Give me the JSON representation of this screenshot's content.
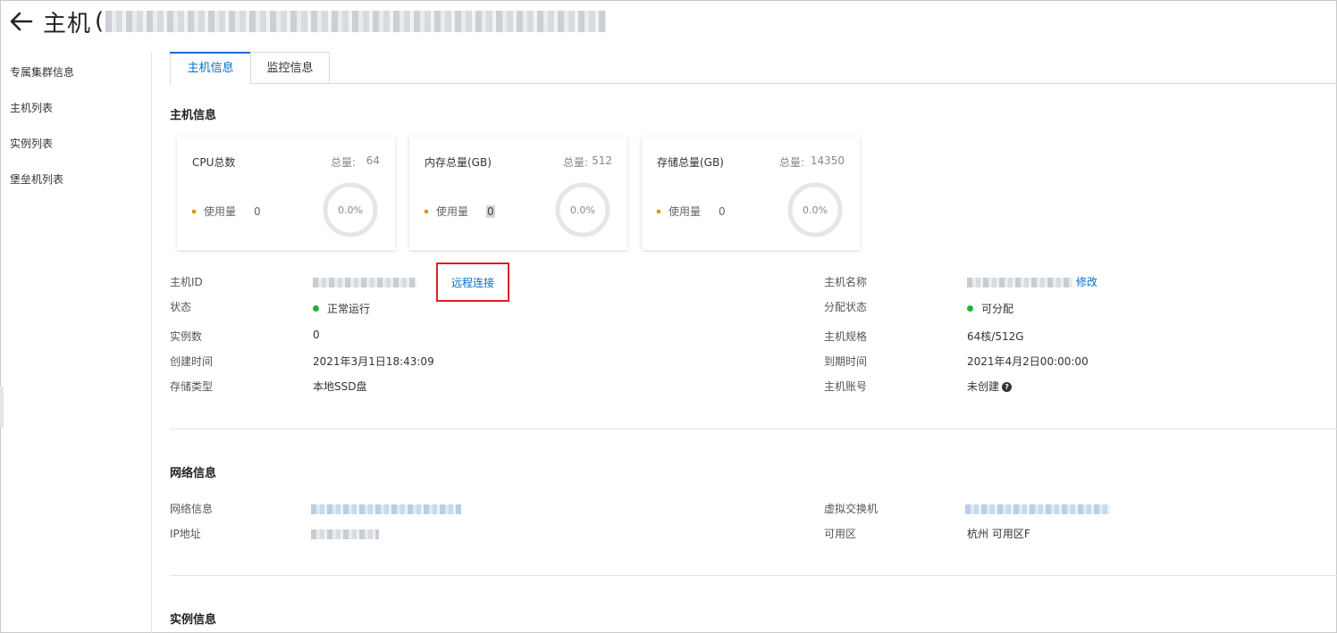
{
  "header": {
    "back_icon": "arrow-left-icon",
    "title": "主机",
    "paren": "("
  },
  "sidebar": {
    "items": [
      {
        "label": "专属集群信息"
      },
      {
        "label": "主机列表"
      },
      {
        "label": "实例列表"
      },
      {
        "label": "堡垒机列表"
      }
    ]
  },
  "tabs": [
    {
      "label": "主机信息"
    },
    {
      "label": "监控信息"
    }
  ],
  "sections": {
    "host_info": "主机信息",
    "network_info": "网络信息",
    "instance_info": "实例信息"
  },
  "cards": [
    {
      "title": "CPU总数",
      "total_label": "总量:",
      "total": "64",
      "used_label": "使用量",
      "used": "0",
      "percent": "0.0%"
    },
    {
      "title": "内存总量(GB)",
      "total_label": "总量:",
      "total": "512",
      "used_label": "使用量",
      "used": "0",
      "percent": "0.0%"
    },
    {
      "title": "存储总量(GB)",
      "total_label": "总量:",
      "total": "14350",
      "used_label": "使用量",
      "used": "0",
      "percent": "0.0%"
    }
  ],
  "host": {
    "id_label": "主机ID",
    "remote_connect": "远程连接",
    "status_label": "状态",
    "status": "正常运行",
    "instances_label": "实例数",
    "instances": "0",
    "created_label": "创建时间",
    "created": "2021年3月1日18:43:09",
    "storage_label": "存储类型",
    "storage": "本地SSD盘",
    "name_label": "主机名称",
    "edit": "修改",
    "alloc_label": "分配状态",
    "alloc": "可分配",
    "spec_label": "主机规格",
    "spec": "64核/512G",
    "expire_label": "到期时间",
    "expire": "2021年4月2日00:00:00",
    "account_label": "主机账号",
    "account": "未创建",
    "help_icon": "question-circle-icon"
  },
  "network": {
    "net_label": "网络信息",
    "ip_label": "IP地址",
    "vswitch_label": "虚拟交换机",
    "zone_label": "可用区",
    "zone": "杭州 可用区F"
  },
  "colors": {
    "accent": "#0070cc",
    "status_green": "#1db33a",
    "highlight_red": "#e02020",
    "usage_dot": "#f08a24"
  }
}
